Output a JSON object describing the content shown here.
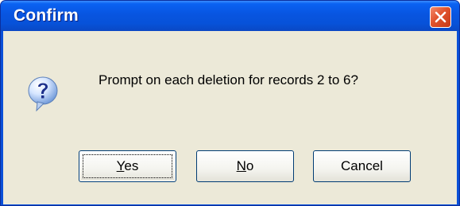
{
  "window": {
    "title": "Confirm"
  },
  "dialog": {
    "message": "Prompt on each deletion for records 2 to 6?",
    "icon": "question-icon"
  },
  "buttons": {
    "yes": {
      "mnemonic": "Y",
      "rest": "es"
    },
    "no": {
      "mnemonic": "N",
      "rest": "o"
    },
    "cancel": {
      "label": "Cancel"
    }
  },
  "colors": {
    "titlebar": "#0855e0",
    "client": "#ece9d8",
    "close_button": "#e0522c",
    "button_border": "#003c74"
  }
}
